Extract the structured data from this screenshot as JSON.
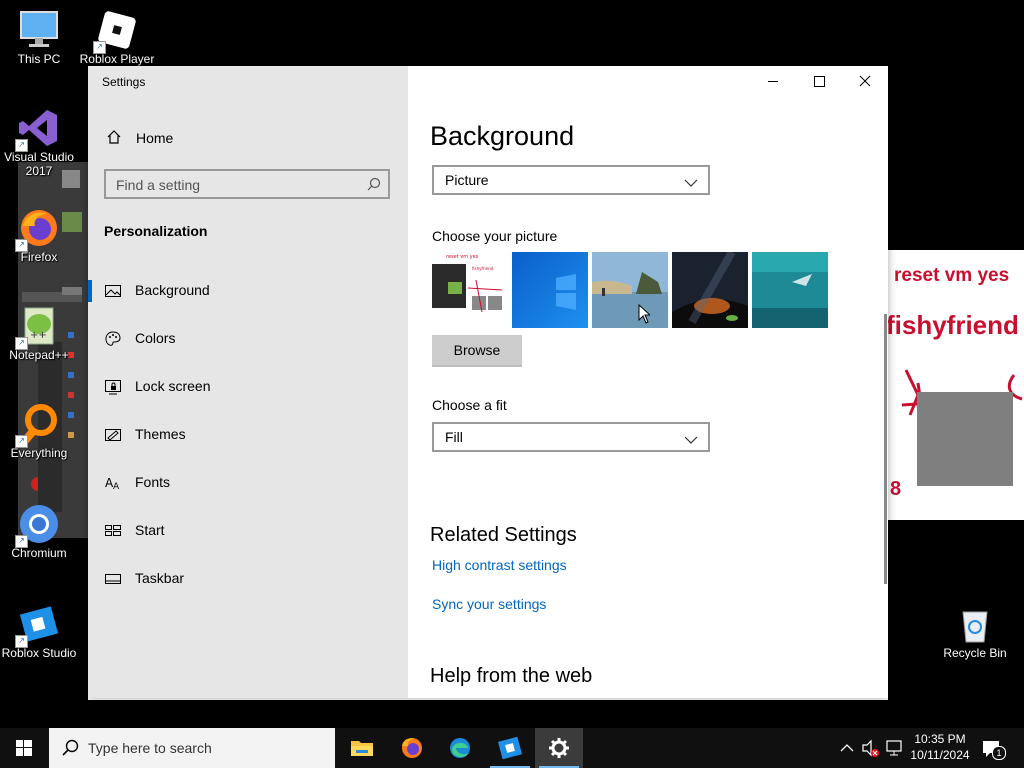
{
  "desktop": {
    "icons": [
      {
        "label": "This PC"
      },
      {
        "label": "Roblox Player"
      },
      {
        "label": "Visual Studio 2017"
      },
      {
        "label": "Firefox"
      },
      {
        "label": "Notepad++"
      },
      {
        "label": "Everything"
      },
      {
        "label": "Chromium"
      },
      {
        "label": "Roblox Studio"
      },
      {
        "label": "Recycle Bin"
      }
    ],
    "wallpaper_text": [
      "reset vm yes",
      "fishyfriend",
      "8"
    ]
  },
  "window": {
    "title": "Settings",
    "controls": {
      "minimize": "minimize",
      "maximize": "maximize",
      "close": "close"
    }
  },
  "nav": {
    "home": "Home",
    "search_placeholder": "Find a setting",
    "section": "Personalization",
    "items": [
      {
        "label": "Background",
        "icon": "picture-icon",
        "active": true
      },
      {
        "label": "Colors",
        "icon": "palette-icon"
      },
      {
        "label": "Lock screen",
        "icon": "lock-screen-icon"
      },
      {
        "label": "Themes",
        "icon": "themes-icon"
      },
      {
        "label": "Fonts",
        "icon": "fonts-icon"
      },
      {
        "label": "Start",
        "icon": "start-icon"
      },
      {
        "label": "Taskbar",
        "icon": "taskbar-icon"
      }
    ]
  },
  "content": {
    "title": "Background",
    "background_type": "Picture",
    "choose_picture_label": "Choose your picture",
    "browse_label": "Browse",
    "choose_fit_label": "Choose a fit",
    "fit_value": "Fill",
    "related_header": "Related Settings",
    "related_links": [
      "High contrast settings",
      "Sync your settings"
    ],
    "help_header": "Help from the web"
  },
  "taskbar": {
    "search_placeholder": "Type here to search",
    "apps": [
      "file-explorer",
      "firefox",
      "edge",
      "roblox-studio",
      "settings"
    ],
    "time": "10:35 PM",
    "date": "10/11/2024",
    "notification_count": "1"
  },
  "colors": {
    "accent": "#0067c0",
    "nav_bg": "#e6e6e6",
    "taskbar": "#101010"
  }
}
